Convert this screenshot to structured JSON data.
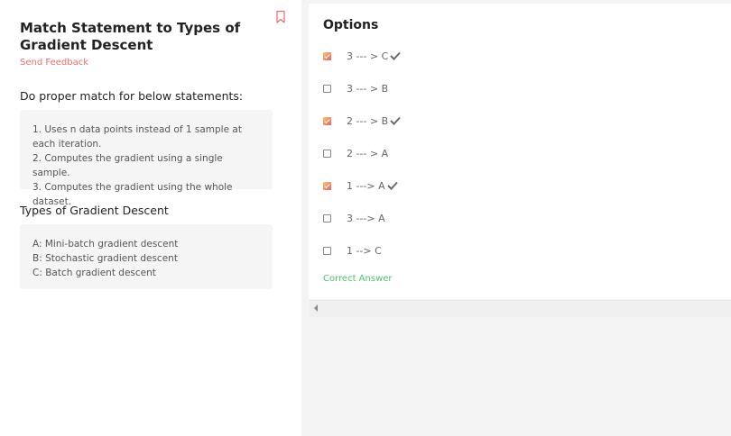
{
  "question": {
    "title": "Match Statement to Types of Gradient Descent",
    "feedback_label": "Send Feedback",
    "prompt_heading": "Do proper match for below statements:",
    "statements": [
      "1. Uses n data points instead of 1 sample at each iteration.",
      "2. Computes the gradient using a single sample.",
      "3. Computes the gradient using the whole dataset."
    ],
    "types_heading": "Types of Gradient Descent",
    "types": [
      "A: Mini-batch gradient descent",
      "B: Stochastic gradient descent",
      "C: Batch gradient descent"
    ]
  },
  "options": {
    "title": "Options",
    "items": [
      {
        "label": "3 --- > C",
        "checked": true,
        "correct": true
      },
      {
        "label": "3 --- > B",
        "checked": false,
        "correct": false
      },
      {
        "label": "2 --- > B",
        "checked": true,
        "correct": true
      },
      {
        "label": "2 --- > A",
        "checked": false,
        "correct": false
      },
      {
        "label": "1 ---> A",
        "checked": true,
        "correct": true
      },
      {
        "label": "3 ---> A",
        "checked": false,
        "correct": false
      },
      {
        "label": "1 --> C",
        "checked": false,
        "correct": false
      }
    ],
    "result_label": "Correct Answer"
  },
  "colors": {
    "accent": "#ef6c6c",
    "correct": "#4ec06f"
  }
}
